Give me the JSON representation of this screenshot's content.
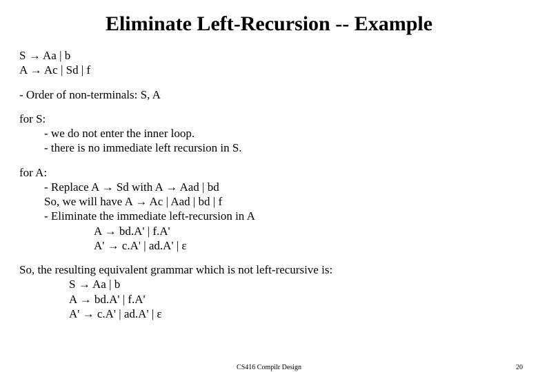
{
  "title": "Eliminate Left-Recursion -- Example",
  "grammar": {
    "rule1_pre": "S ",
    "rule1_post": " Aa | b",
    "rule2_pre": "A ",
    "rule2_post": " Ac | Sd | f"
  },
  "order": "- Order of non-terminals: S, A",
  "forS": {
    "head": "for S:",
    "line1": "- we do not enter the inner loop.",
    "line2": "- there is no immediate left recursion in S."
  },
  "forA": {
    "head": "for A:",
    "replace_pre": "- Replace A ",
    "replace_mid": " Sd   with   A ",
    "replace_post": " Aad | bd",
    "so_pre": "So, we will have   A ",
    "so_post": " Ac | Aad | bd | f",
    "elim": "- Eliminate the immediate left-recursion in A",
    "r1_pre": "A ",
    "r1_post": " bd.A' | f.A'",
    "r2_pre": "A' ",
    "r2_post": " c.A' |  ad.A' | ε"
  },
  "result": {
    "head": "So, the resulting equivalent grammar which is not left-recursive is:",
    "r1_pre": "S ",
    "r1_post": " Aa | b",
    "r2_pre": "A ",
    "r2_post": " bd.A' | f.A'",
    "r3_pre": "A' ",
    "r3_post": " c.A' |  ad.A' | ε"
  },
  "footer": {
    "center": "CS416 Compilr Design",
    "pageno": "20"
  },
  "glyphs": {
    "arrow": "→"
  }
}
